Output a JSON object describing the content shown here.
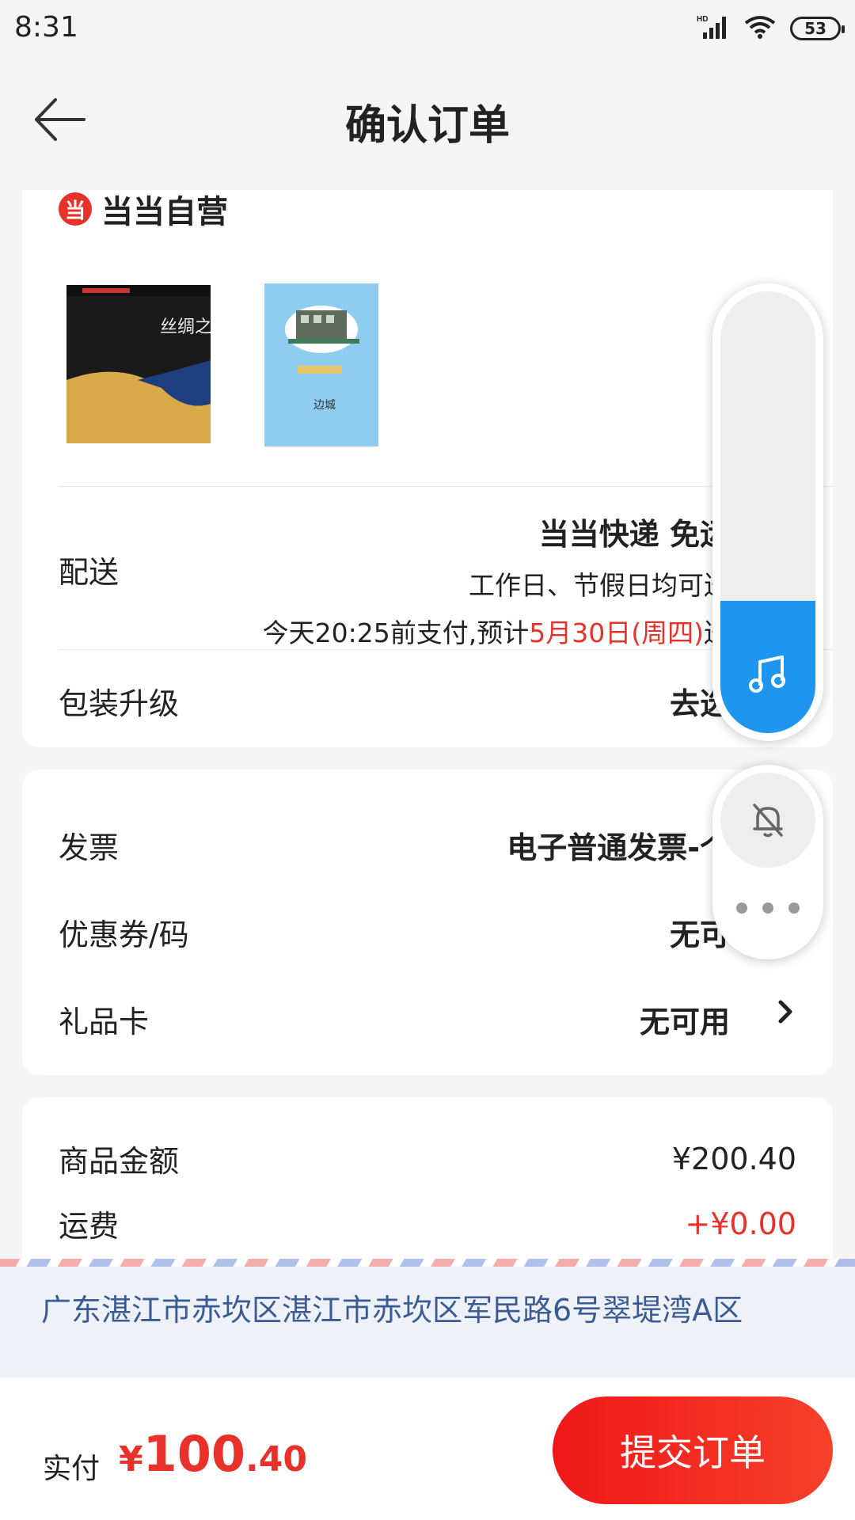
{
  "status_bar": {
    "time": "8:31",
    "network": "HD",
    "battery": "53"
  },
  "header": {
    "title": "确认订单"
  },
  "shop": {
    "logo_char": "当",
    "name": "当当自营"
  },
  "products": [
    {
      "title": "丝绸之路"
    },
    {
      "title": "边城"
    }
  ],
  "delivery": {
    "label": "配送",
    "method": "当当快递 免运",
    "days": "工作日、节假日均可送",
    "eta_prefix": "今天20:25前支付,预计",
    "eta_date": "5月30日(周四)",
    "eta_suffix": "送"
  },
  "packaging": {
    "label": "包装升级",
    "value": "去选"
  },
  "invoice": {
    "label": "发票",
    "value": "电子普通发票-个"
  },
  "coupon": {
    "label": "优惠券/码",
    "value": "无可"
  },
  "giftcard": {
    "label": "礼品卡",
    "value": "无可用"
  },
  "price": {
    "subtotal_label": "商品金额",
    "subtotal": "¥200.40",
    "shipping_label": "运费",
    "shipping": "+¥0.00"
  },
  "address": {
    "text": "广东湛江市赤坎区湛江市赤坎区军民路6号翠堤湾A区"
  },
  "footer": {
    "pay_label": "实付",
    "currency": "¥",
    "amount_int": "100",
    "amount_dec": ".40",
    "submit_label": "提交订单"
  },
  "floating": {
    "volume_level": 0.3,
    "volume_color": "#1e96f0"
  },
  "colors": {
    "accent": "#e8312a",
    "address_text": "#3b5b94"
  }
}
